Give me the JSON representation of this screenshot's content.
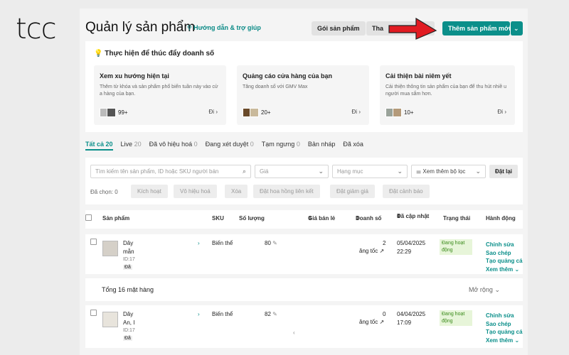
{
  "brand": "tcc",
  "header": {
    "title": "Quản lý sản phẩm",
    "help_link": "Hướng dẫn & trợ giúp",
    "btn_package": "Gói sản phẩm",
    "btn_more": "Tha",
    "btn_add": "Thêm sản phẩm mới"
  },
  "insights": {
    "heading": "Thực hiện để thúc đẩy doanh số",
    "cards": [
      {
        "title": "Xem xu hướng hiện tại",
        "desc": "Thêm từ khóa và sản phẩm phổ biến tuần này vào cử a hàng của bạn.",
        "count": "99+",
        "go": "Đi"
      },
      {
        "title": "Quảng cáo cửa hàng của bạn",
        "desc": "Tăng doanh số với GMV Max",
        "count": "20+",
        "go": "Đi"
      },
      {
        "title": "Cải thiện bài niêm yết",
        "desc": "Cải thiện thông tin sản phẩm của bạn để thu hút nhiề u người mua sắm hơn.",
        "count": "10+",
        "go": "Đi"
      }
    ]
  },
  "tabs": [
    {
      "label": "Tất cả",
      "count": "20"
    },
    {
      "label": "Live",
      "count": "20"
    },
    {
      "label": "Đã vô hiệu hoá",
      "count": "0"
    },
    {
      "label": "Đang xét duyệt",
      "count": "0"
    },
    {
      "label": "Tạm ngưng",
      "count": "0"
    },
    {
      "label": "Bản nháp",
      "count": ""
    },
    {
      "label": "Đã xóa",
      "count": ""
    }
  ],
  "filters": {
    "search_placeholder": "Tìm kiếm tên sản phẩm, ID hoặc SKU người bán",
    "price": "Giá",
    "category": "Hạng mục",
    "more_filters": "Xem thêm bộ lọc",
    "reset": "Đặt lại",
    "selected": "Đã chọn: 0",
    "bulk": [
      "Kích hoạt",
      "Vô hiệu hoá",
      "Xóa",
      "Đặt hoa hồng liên kết",
      "Đặt giảm giá",
      "Đặt cảnh báo"
    ]
  },
  "table": {
    "headers": {
      "product": "Sản phẩm",
      "sku": "SKU",
      "qty": "Số lượng",
      "price": "Giá bán lẻ",
      "sales": "Doanh số",
      "updated": "Đã cập nhật",
      "status": "Trạng thái",
      "action": "Hành động"
    },
    "rows": [
      {
        "name1": "Dây",
        "name2": "mẫn",
        "id": "ID:17",
        "tag": "Đã",
        "sku": "Biến thể",
        "qty": "80",
        "sales": "2",
        "boost": "ăng tốc",
        "date": "05/04/2025",
        "time": "22:29",
        "status": "Đang hoạt động"
      },
      {
        "name1": "Dây",
        "name2": "An, I",
        "id": "ID:17",
        "tag": "Đã",
        "sku": "Biến thể",
        "qty": "82",
        "sales": "0",
        "boost": "ăng tốc",
        "date": "04/04/2025",
        "time": "17:09",
        "status": "Đang hoạt động"
      }
    ],
    "actions": [
      "Chỉnh sửa",
      "Sao chép",
      "Tạo quảng cáo",
      "Xem thêm"
    ],
    "total": "Tổng 16 mặt hàng",
    "expand": "Mở rộng"
  },
  "colors": {
    "accent": "#0b8f8a",
    "arrow": "#e11b22"
  }
}
